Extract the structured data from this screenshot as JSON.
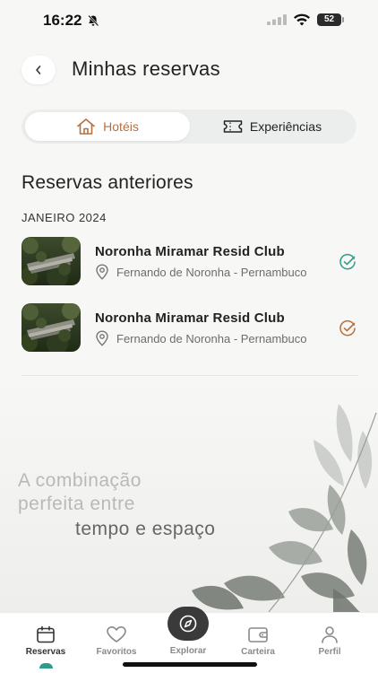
{
  "status_bar": {
    "time": "16:22",
    "battery": "52",
    "icons": [
      "bell-muted-icon",
      "signal-icon",
      "wifi-icon",
      "battery-icon"
    ]
  },
  "header": {
    "back_icon": "chevron-left-icon",
    "title": "Minhas reservas"
  },
  "tabs": [
    {
      "label": "Hotéis",
      "icon": "house-icon",
      "active": true
    },
    {
      "label": "Experiências",
      "icon": "ticket-icon",
      "active": false
    }
  ],
  "section": {
    "title": "Reservas anteriores",
    "month": "JANEIRO 2024"
  },
  "bookings": [
    {
      "name": "Noronha Miramar Resid Club",
      "location": "Fernando de Noronha - Pernambuco",
      "status_icon": "check-circle-icon",
      "status_color": "#2f9c8b"
    },
    {
      "name": "Noronha Miramar Resid Club",
      "location": "Fernando de Noronha - Pernambuco",
      "status_icon": "check-circle-icon",
      "status_color": "#b7703c"
    }
  ],
  "tagline": {
    "line1": "A combinação",
    "line2": "perfeita entre",
    "line3": "tempo e espaço"
  },
  "nav": {
    "items": [
      {
        "label": "Reservas",
        "icon": "calendar-icon",
        "active": true
      },
      {
        "label": "Favoritos",
        "icon": "heart-icon",
        "active": false
      },
      {
        "label": "Explorar",
        "icon": "compass-icon",
        "active": false
      },
      {
        "label": "Carteira",
        "icon": "wallet-icon",
        "active": false
      },
      {
        "label": "Perfil",
        "icon": "user-icon",
        "active": false
      }
    ]
  },
  "colors": {
    "accent": "#b7703c",
    "teal": "#2f9c8b",
    "background": "#f7f7f6"
  }
}
